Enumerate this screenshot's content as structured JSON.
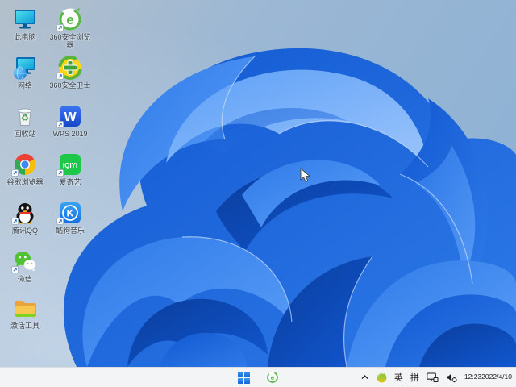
{
  "wallpaper": {
    "name": "windows-11-bloom",
    "bg_top_left": "#b3c0cc",
    "bg_right": "#8fb2d4",
    "bg_bottom": "#b7cde2",
    "bloom_dark": "#0a3d9c",
    "bloom_mid": "#1258d0",
    "bloom_bright": "#2e7ae9",
    "bloom_light": "#5c9ff7"
  },
  "desktop": {
    "icons": [
      {
        "name": "this-pc",
        "label": "此电脑"
      },
      {
        "name": "360-browser",
        "label": "360安全浏览器",
        "glyph": "e"
      },
      {
        "name": "network",
        "label": "网络"
      },
      {
        "name": "360-safe",
        "label": "360安全卫士"
      },
      {
        "name": "recycle-bin",
        "label": "回收站",
        "glyph": "♻"
      },
      {
        "name": "wps",
        "label": "WPS 2019",
        "glyph": "W"
      },
      {
        "name": "chrome",
        "label": "谷歌浏览器"
      },
      {
        "name": "iqiyi",
        "label": "爱奇艺",
        "glyph": "iQIYI"
      },
      {
        "name": "qq",
        "label": "腾讯QQ"
      },
      {
        "name": "kugou",
        "label": "酷狗音乐",
        "glyph": "K"
      },
      {
        "name": "wechat",
        "label": "微信"
      },
      {
        "name": "activation-folder",
        "label": "激活工具"
      }
    ]
  },
  "taskbar": {
    "pinned": [
      "start",
      "360-browser"
    ],
    "tray": {
      "ime_language": "英",
      "ime_mode": "拼",
      "time": "12:23",
      "date": "2022/4/10"
    }
  },
  "colors": {
    "accent_blue": "#1a6fe0",
    "taskbar_bg": "#f3f4f6",
    "icon_360_green": "#57b846",
    "icon_360_yellow": "#ffd416",
    "wechat_green": "#51c332",
    "iqiyi_green": "#1cc749"
  }
}
